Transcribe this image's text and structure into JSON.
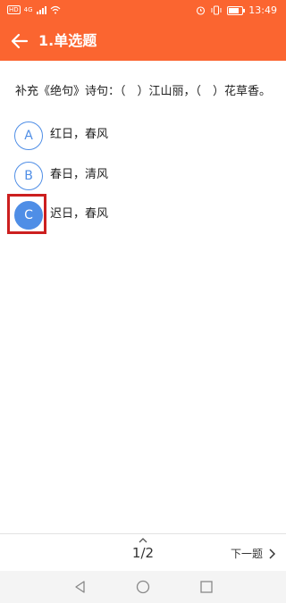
{
  "status": {
    "network_badge": "HD",
    "network_type": "4G",
    "time": "13:49"
  },
  "header": {
    "title": "1.单选题"
  },
  "question": {
    "text": "补充《绝句》诗句：（　）江山丽，（　）花草香。",
    "options": [
      {
        "letter": "A",
        "text": "红日，春风",
        "selected": false
      },
      {
        "letter": "B",
        "text": "春日，清风",
        "selected": false
      },
      {
        "letter": "C",
        "text": "迟日，春风",
        "selected": true
      }
    ]
  },
  "footer": {
    "page_indicator": "1/2",
    "next_label": "下一题"
  },
  "colors": {
    "accent": "#fb6530",
    "option_blue": "#4f8ee6",
    "highlight_red": "#cc1f1f"
  },
  "icons": {
    "back": "arrow-left-icon",
    "up": "chevron-up-icon",
    "next": "chevron-right-icon"
  }
}
